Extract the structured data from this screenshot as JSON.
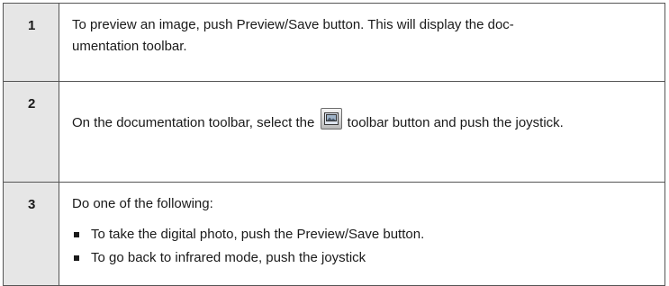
{
  "steps": [
    {
      "number": "1",
      "text": "To preview an image, push Preview/Save button. This will display the doc-umentation toolbar."
    },
    {
      "number": "2",
      "text_before": "On the documentation toolbar, select the ",
      "icon": "image-toolbar-icon",
      "text_after": " toolbar button and push the joystick."
    },
    {
      "number": "3",
      "text": "Do one of the following:",
      "bullets": [
        "To take the digital photo, push the Preview/Save button.",
        "To go back to infrared mode, push the joystick"
      ]
    }
  ]
}
